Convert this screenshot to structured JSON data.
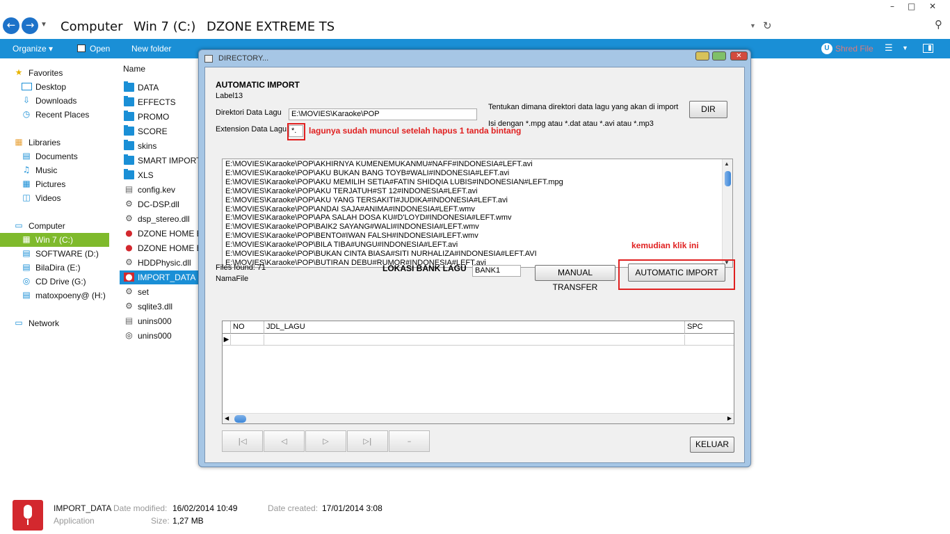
{
  "explorer": {
    "breadcrumbs": [
      "Computer",
      "Win 7 (C:)",
      "DZONE EXTREME TS"
    ],
    "window_controls": [
      "–",
      "□",
      "✕"
    ],
    "toolbar": {
      "organize": "Organize ▾",
      "open": "Open",
      "new_folder": "New folder",
      "shred": "Shred File"
    },
    "nav_pane": {
      "favorites": {
        "label": "Favorites",
        "items": [
          "Desktop",
          "Downloads",
          "Recent Places"
        ]
      },
      "libraries": {
        "label": "Libraries",
        "items": [
          "Documents",
          "Music",
          "Pictures",
          "Videos"
        ]
      },
      "computer": {
        "label": "Computer",
        "items": [
          "Win 7 (C:)",
          "SOFTWARE (D:)",
          "BilaDira (E:)",
          "CD Drive (G:)",
          "matoxpoeny@ (H:)"
        ],
        "selected": "Win 7 (C:)"
      },
      "network": "Network"
    },
    "file_list": {
      "column": "Name",
      "items": [
        {
          "name": "DATA",
          "icon": "folder-icon"
        },
        {
          "name": "EFFECTS",
          "icon": "folder-icon"
        },
        {
          "name": "PROMO",
          "icon": "folder-icon"
        },
        {
          "name": "SCORE",
          "icon": "folder-icon"
        },
        {
          "name": "skins",
          "icon": "folder-icon"
        },
        {
          "name": "SMART IMPORT",
          "icon": "folder-icon"
        },
        {
          "name": "XLS",
          "icon": "folder-icon"
        },
        {
          "name": "config.kev",
          "icon": "file-icon"
        },
        {
          "name": "DC-DSP.dll",
          "icon": "gear-icon"
        },
        {
          "name": "dsp_stereo.dll",
          "icon": "gear-icon"
        },
        {
          "name": "DZONE HOME EX",
          "icon": "microphone-icon"
        },
        {
          "name": "DZONE HOME EX",
          "icon": "microphone-icon"
        },
        {
          "name": "HDDPhysic.dll",
          "icon": "gear-icon"
        },
        {
          "name": "IMPORT_DATA",
          "icon": "microphone-icon",
          "selected": true
        },
        {
          "name": "set",
          "icon": "gear-icon"
        },
        {
          "name": "sqlite3.dll",
          "icon": "gear-icon"
        },
        {
          "name": "unins000",
          "icon": "file-icon"
        },
        {
          "name": "unins000",
          "icon": "disc-icon"
        }
      ]
    },
    "details": {
      "name": "IMPORT_DATA",
      "type": "Application",
      "date_modified_label": "Date modified:",
      "date_modified": "16/02/2014 10:49",
      "date_created_label": "Date created:",
      "date_created": "17/01/2014 3:08",
      "size_label": "Size:",
      "size": "1,27 MB"
    }
  },
  "dialog": {
    "title": "DIRECTORY...",
    "heading": "AUTOMATIC IMPORT",
    "label13": "Label13",
    "dir_label": "Direktori Data Lagu",
    "dir_value": "E:\\MOVIES\\Karaoke\\POP",
    "ext_label": "Extension Data Lagu",
    "ext_value": "*.",
    "hint1": "Tentukan dimana direktori data lagu yang akan di import",
    "hint2": "Isi dengan *.mpg atau *.dat atau *.avi atau *.mp3",
    "dir_button": "DIR",
    "annotation_ext": "lagunya sudah muncul setelah hapus 1 tanda bintang",
    "annotation_click": "kemudian klik ini",
    "files": [
      "E:\\MOVIES\\Karaoke\\POP\\AKHIRNYA KUMENEMUKANMU#NAFF#INDONESIA#LEFT.avi",
      "E:\\MOVIES\\Karaoke\\POP\\AKU BUKAN BANG TOYB#WALI#INDONESIA#LEFT.avi",
      "E:\\MOVIES\\Karaoke\\POP\\AKU MEMILIH SETIA#FATIN SHIDQIA LUBIS#INDONESIAN#LEFT.mpg",
      "E:\\MOVIES\\Karaoke\\POP\\AKU TERJATUH#ST 12#INDONESIA#LEFT.avi",
      "E:\\MOVIES\\Karaoke\\POP\\AKU YANG TERSAKITI#JUDIKA#INDONESIA#LEFT.avi",
      "E:\\MOVIES\\Karaoke\\POP\\ANDAI SAJA#ANIMA#INDONESIA#LEFT.wmv",
      "E:\\MOVIES\\Karaoke\\POP\\APA SALAH DOSA KU#D'LOYD#INDONESIA#LEFT.wmv",
      "E:\\MOVIES\\Karaoke\\POP\\BAIK2 SAYANG#WALI#INDONESIA#LEFT.wmv",
      "E:\\MOVIES\\Karaoke\\POP\\BENTO#IWAN FALSH#INDONESIA#LEFT.wmv",
      "E:\\MOVIES\\Karaoke\\POP\\BILA TIBA#UNGU#INDONESIA#LEFT.avi",
      "E:\\MOVIES\\Karaoke\\POP\\BUKAN CINTA BIASA#SITI NURHALIZA#INDONESIA#LEFT.AVI",
      "E:\\MOVIES\\Karaoke\\POP\\BUTIRAN DEBU#RUMOR#INDONESIA#LEFT.avi"
    ],
    "files_found": "Files found: 71",
    "namafile": "NamaFile",
    "lokasi_label": "LOKASI BANK LAGU",
    "lokasi_value": "BANK1",
    "manual_transfer": "MANUAL TRANSFER",
    "automatic_import": "AUTOMATIC IMPORT",
    "grid_columns": [
      "NO",
      "JDL_LAGU",
      "SPC"
    ],
    "nav_buttons": [
      "|◁",
      "◁",
      "▷",
      "▷|",
      "–"
    ],
    "keluar": "KELUAR"
  }
}
